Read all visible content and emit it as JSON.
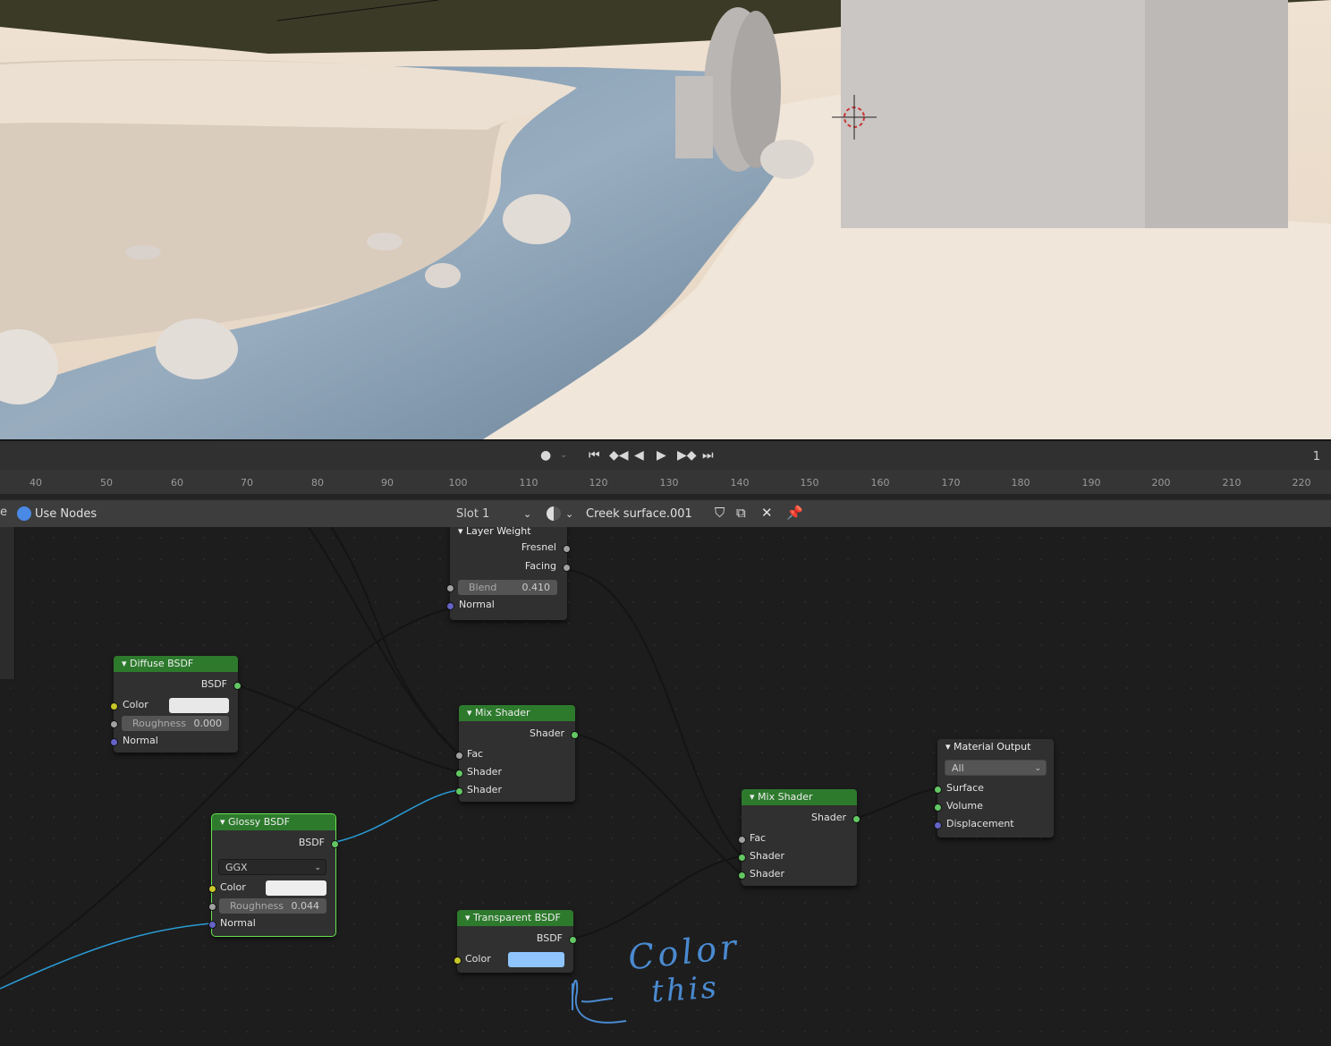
{
  "timeline": {
    "frame_current": "1",
    "ruler_ticks": [
      "40",
      "50",
      "60",
      "70",
      "80",
      "90",
      "100",
      "110",
      "120",
      "130",
      "140",
      "150",
      "160",
      "170",
      "180",
      "190",
      "200",
      "210",
      "220"
    ]
  },
  "node_header": {
    "use_nodes_label": "Use Nodes",
    "slot_label": "Slot 1",
    "material_name": "Creek surface.001"
  },
  "nodes": {
    "layer_weight": {
      "title": "Layer Weight",
      "out_fresnel": "Fresnel",
      "out_facing": "Facing",
      "blend_label": "Blend",
      "blend_value": "0.410",
      "in_normal": "Normal"
    },
    "diffuse": {
      "title": "Diffuse BSDF",
      "out_bsdf": "BSDF",
      "color_label": "Color",
      "color_value": "#e8e8e8",
      "roughness_label": "Roughness",
      "roughness_value": "0.000",
      "normal_label": "Normal"
    },
    "mix1": {
      "title": "Mix Shader",
      "out_shader": "Shader",
      "fac": "Fac",
      "shader1": "Shader",
      "shader2": "Shader"
    },
    "glossy": {
      "title": "Glossy BSDF",
      "out_bsdf": "BSDF",
      "distribution": "GGX",
      "color_label": "Color",
      "color_value": "#eeeeee",
      "roughness_label": "Roughness",
      "roughness_value": "0.044",
      "normal_label": "Normal"
    },
    "mix2": {
      "title": "Mix Shader",
      "out_shader": "Shader",
      "fac": "Fac",
      "shader1": "Shader",
      "shader2": "Shader"
    },
    "transparent": {
      "title": "Transparent BSDF",
      "out_bsdf": "BSDF",
      "color_label": "Color",
      "color_value": "#8ec5fc"
    },
    "output": {
      "title": "Material Output",
      "target": "All",
      "surface": "Surface",
      "volume": "Volume",
      "displacement": "Displacement"
    }
  },
  "annotation": {
    "line1": "Color",
    "line2": "this",
    "color": "#4a8ad0"
  },
  "colors": {
    "node_header_green": "#2d7a2d",
    "wire_selected": "#2a9bd4",
    "socket_green": "#63c763",
    "socket_yellow": "#c7c729",
    "socket_blue": "#6363c7",
    "socket_grey": "#a1a1a1"
  }
}
